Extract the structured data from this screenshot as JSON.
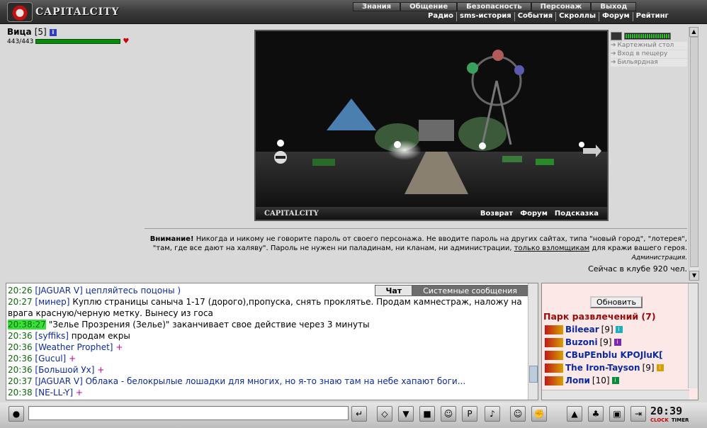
{
  "logo": {
    "text": "CAPITALCITY"
  },
  "menu": {
    "primary": [
      "Знания",
      "Общение",
      "Безопасность",
      "Персонаж",
      "Выход"
    ],
    "secondary": [
      "Радио",
      "sms-история",
      "События",
      "Скроллы",
      "Форум",
      "Рейтинг"
    ]
  },
  "player": {
    "name": "Вица",
    "level": "[5]",
    "hp": "443/443",
    "hp_fraction": 1.0
  },
  "scene": {
    "brand": "CAPITALCITY",
    "links": [
      "Возврат",
      "Форум",
      "Подсказка"
    ]
  },
  "locations": [
    "Картежный стол",
    "Вход в пещеру",
    "Бильярдная"
  ],
  "warning": {
    "bold": "Внимание!",
    "text1": " Никогда и никому не говорите пароль от своего персонажа. Не вводите пароль на других сайтах, типа \"новый город\", \"лотерея\", \"там, где все дают на халяву\". Пароль не нужен ни паладинам, ни кланам, ни администрации, ",
    "link": "только взломщикам",
    "text2": " для кражи вашего героя.",
    "admin": "Администрация.",
    "online": "Сейчас в клубе 920 чел."
  },
  "chat": {
    "tabs": [
      "Чат",
      "Системные сообщения"
    ],
    "lines": [
      {
        "time": "20:26",
        "who": "[JAGUAR V]",
        "msg": "цепляйтесь поцоны )",
        "style": "blue"
      },
      {
        "time": "20:27",
        "who": "[минер]",
        "msg": "Куплю страницы саныча 1-17 (дорого),пропуска, снять проклятье. Продам камнестраж, наложу на врага красную/черную метку. Вынесу из госа",
        "style": "normal"
      },
      {
        "time": "20:38:27",
        "who": "",
        "msg": "\"Зелье Прозрения (Зелье)\" заканчивает свое действие через 3 минуты",
        "style": "system"
      },
      {
        "time": "20:36",
        "who": "[syffiks]",
        "msg": "продам екры",
        "style": "normal"
      },
      {
        "time": "20:36",
        "who": "[Weather Prophet]",
        "msg": "+",
        "style": "plus"
      },
      {
        "time": "20:36",
        "who": "[Gucul]",
        "msg": "+",
        "style": "plus"
      },
      {
        "time": "20:36",
        "who": "[Большой Ух]",
        "msg": "+",
        "style": "plus"
      },
      {
        "time": "20:37",
        "who": "[JAGUAR V]",
        "msg": "Облака - белокрылые лошадки для многих, но я-то знаю там на небе хапают боги...",
        "style": "blue"
      },
      {
        "time": "20:38",
        "who": "[NE-LL-Y]",
        "msg": "+",
        "style": "plus"
      }
    ]
  },
  "users": {
    "refresh_label": "Обновить",
    "room": "Парк развлечений (7)",
    "list": [
      {
        "name": "Bileear",
        "level": "[9]",
        "badge_color": "#1ab0c0"
      },
      {
        "name": "Buzoni",
        "level": "[9]",
        "badge_color": "#7a2ab0"
      },
      {
        "name": "CBuPEnblu KPOJluK[",
        "level": "",
        "badge_color": ""
      },
      {
        "name": "The Iron-Tayson",
        "level": "[9]",
        "badge_color": "#d6a000"
      },
      {
        "name": "Лопи",
        "level": "[10]",
        "badge_color": "#0a8a3a"
      }
    ]
  },
  "clock": {
    "time": "20:39",
    "labels": [
      "CLOCK",
      "TIMER"
    ]
  }
}
